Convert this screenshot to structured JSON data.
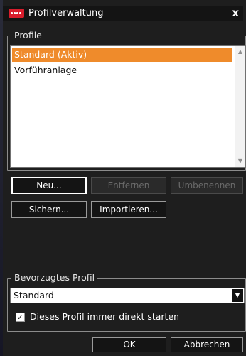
{
  "window": {
    "title": "Profilverwaltung",
    "close_glyph": "x"
  },
  "profiles_group": {
    "title": "Profile",
    "items": [
      {
        "label": "Standard (Aktiv)",
        "selected": true
      },
      {
        "label": "Vorführanlage",
        "selected": false
      }
    ]
  },
  "buttons": {
    "new": "Neu...",
    "remove": "Entfernen",
    "rename": "Umbenennen",
    "save": "Sichern...",
    "import": "Importieren..."
  },
  "preferred_group": {
    "title": "Bevorzugtes Profil",
    "selected_value": "Standard"
  },
  "checkbox": {
    "label": "Dieses Profil immer direkt starten",
    "checked": true
  },
  "footer": {
    "ok": "OK",
    "cancel": "Abbrechen"
  },
  "colors": {
    "selection": "#ef8b2b",
    "app_icon": "#d81d2c"
  },
  "icons": {
    "app": "app-icon",
    "scroll_up": "scroll-up-icon",
    "scroll_down": "scroll-down-icon",
    "combo_arrow": "chevron-down-icon",
    "check": "checkmark-icon"
  }
}
